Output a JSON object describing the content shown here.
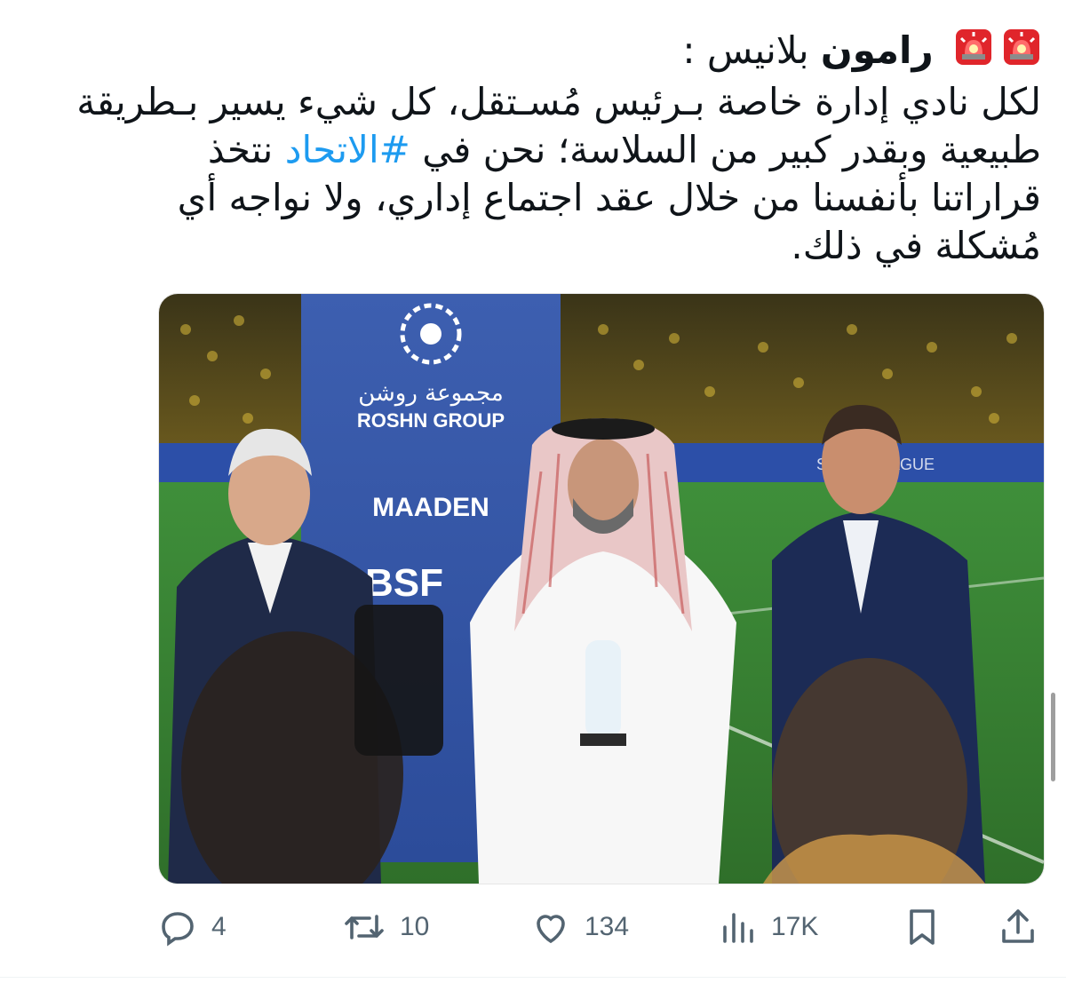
{
  "tweet": {
    "header_emojis": [
      "siren-emoji",
      "siren-emoji"
    ],
    "author_first": "رامون",
    "author_rest": "بلانيس :",
    "line1": "لكل نادي إدارة خاصة بـرئيس مُسـتقل، كل شيء يسير بـطريقة",
    "line2_before": "طبيعية وبقدر كبير من السلاسة؛ نحن في",
    "hashtag": "#الاتحاد",
    "line2_after": "نتخذ",
    "line3": "قراراتنا بأنفسنا من خلال عقد اجتماع إداري، ولا نواجه أي",
    "line4": "مُشكلة في ذلك."
  },
  "media": {
    "banner_brand_ar": "مجموعة روشن",
    "banner_brand_en": "ROSHN GROUP",
    "banner_sponsor_1": "MAADEN",
    "banner_sponsor_2": "BSF",
    "board_text": "SAUDI LEAGUE"
  },
  "actions": {
    "replies": "4",
    "reposts": "10",
    "likes": "134",
    "views": "17K"
  },
  "colors": {
    "text": "#0f1419",
    "secondary": "#536471",
    "link": "#1d9bf0",
    "siren_red": "#e0252b"
  }
}
